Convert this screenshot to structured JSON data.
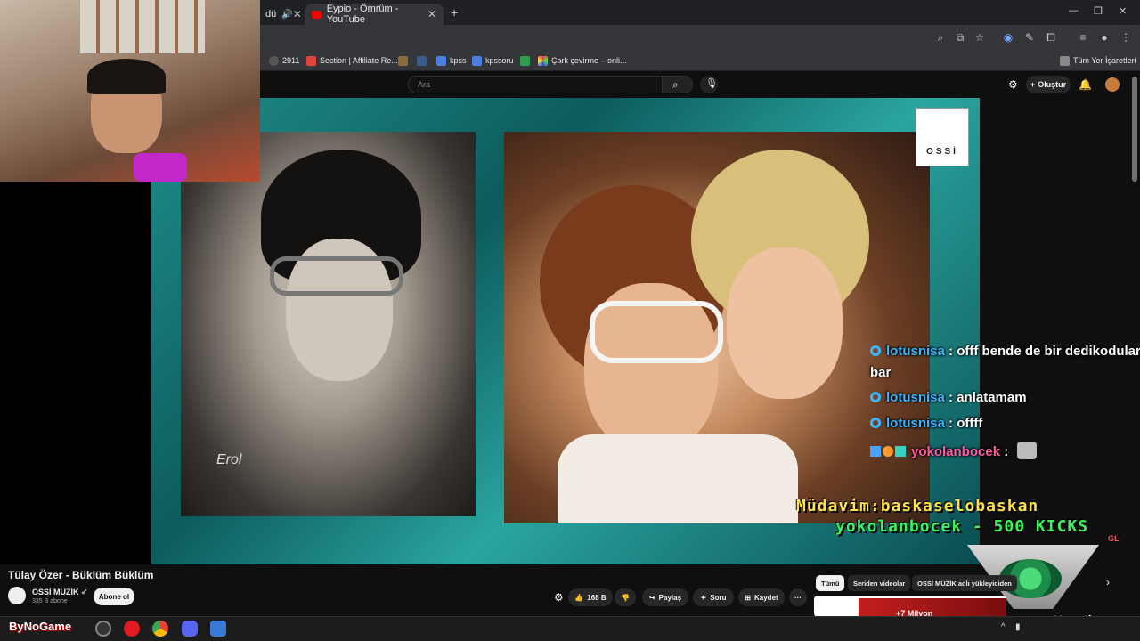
{
  "browser": {
    "tabs": [
      {
        "label": "dü",
        "active": false
      },
      {
        "label": "Eypio - Ömrüm - YouTube",
        "active": true
      }
    ],
    "new_tab": "+",
    "bookmarks": [
      {
        "label": "2911"
      },
      {
        "label": "Section | Affiliate Re..."
      },
      {
        "label": ""
      },
      {
        "label": ""
      },
      {
        "label": "kpss"
      },
      {
        "label": "kpssoru"
      },
      {
        "label": ""
      },
      {
        "label": "Çark çevirme – onli..."
      }
    ],
    "all_bookmarks": "Tüm Yer İşaretleri"
  },
  "youtube": {
    "search_placeholder": "Ara",
    "create_label": "Oluştur"
  },
  "video": {
    "logo_text": "OSSİ",
    "title": "Tülay Özer - Büklüm Büklüm",
    "channel": "OSSİ MÜZİK",
    "subscribers": "335 B abone",
    "subscribe_label": "Abone ol",
    "likes": "168 B",
    "share": "Paylaş",
    "ask": "Soru",
    "save": "Kaydet",
    "more": "···"
  },
  "chips": [
    {
      "label": "Tümü",
      "selected": true
    },
    {
      "label": "Seriden videolar",
      "selected": false
    },
    {
      "label": "OSSİ MÜZİK adlı yükleyiciden",
      "selected": false
    }
  ],
  "chat": [
    {
      "user": "lotusnisa",
      "message": " : offf bende de bir dedikodular"
    },
    {
      "user": "",
      "message": "bar"
    },
    {
      "user": "lotusnisa",
      "message": " : anlatamam"
    },
    {
      "user": "lotusnisa",
      "message": " : offff"
    },
    {
      "user": "yokolanbocek",
      "message": " :"
    }
  ],
  "alerts": {
    "line1": "Müdavim:baskaselobaskan",
    "line2": "yokolanbocek - 500 KICKS"
  },
  "overlay": {
    "views": "+7 Milyon",
    "section_brand": "section",
    "bynogame": "ByNoGame"
  },
  "colors": {
    "accent_chat_user": "#3ab5ff",
    "alert_line1": "#ffe14d",
    "alert_line2": "#3df25a",
    "video_teal": "#1f8f8a"
  }
}
